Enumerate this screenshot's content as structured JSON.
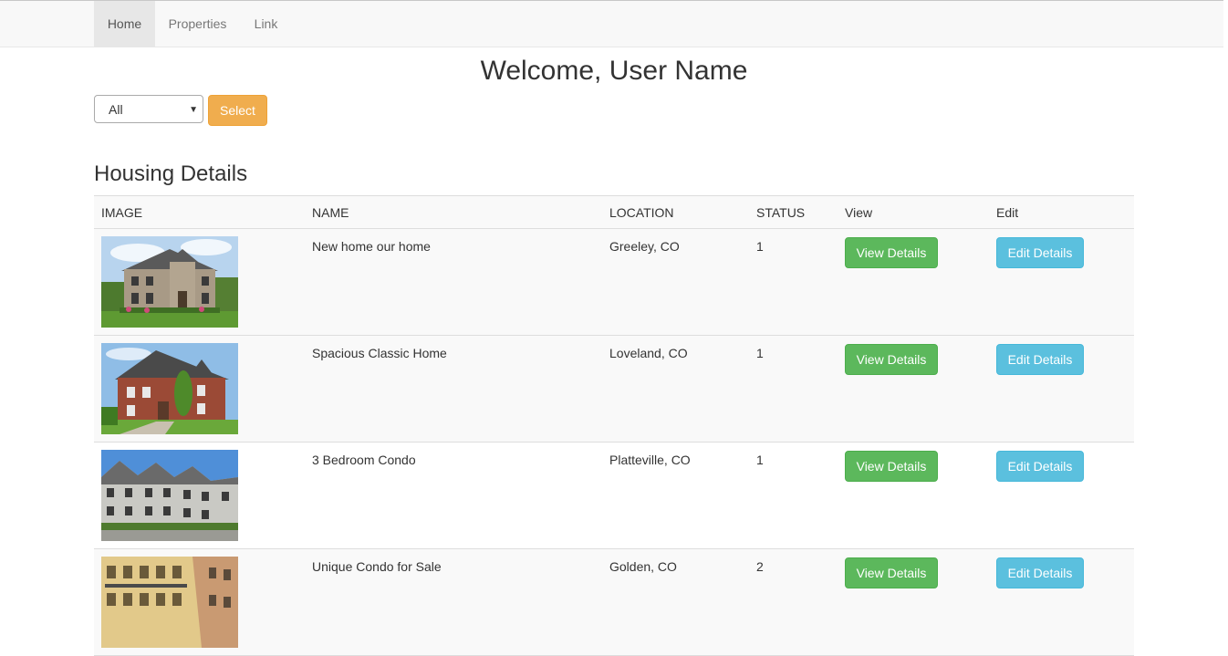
{
  "nav": {
    "items": [
      {
        "label": "Home",
        "active": true
      },
      {
        "label": "Properties",
        "active": false
      },
      {
        "label": "Link",
        "active": false
      }
    ]
  },
  "welcome": "Welcome, User Name",
  "filter": {
    "selected": "All",
    "button_label": "Select"
  },
  "section_title": "Housing Details",
  "table": {
    "headers": [
      "IMAGE",
      "NAME",
      "LOCATION",
      "STATUS",
      "View",
      "Edit"
    ],
    "rows": [
      {
        "name": "New home our home",
        "location": "Greeley, CO",
        "status": "1",
        "view_label": "View Details",
        "edit_label": "Edit Details",
        "image": "stone-house-photo"
      },
      {
        "name": "Spacious Classic Home",
        "location": "Loveland, CO",
        "status": "1",
        "view_label": "View Details",
        "edit_label": "Edit Details",
        "image": "brick-house-photo"
      },
      {
        "name": "3 Bedroom Condo",
        "location": "Platteville, CO",
        "status": "1",
        "view_label": "View Details",
        "edit_label": "Edit Details",
        "image": "townhouse-row-photo"
      },
      {
        "name": "Unique Condo for Sale",
        "location": "Golden, CO",
        "status": "2",
        "view_label": "View Details",
        "edit_label": "Edit Details",
        "image": "yellow-condo-photo"
      }
    ]
  },
  "colors": {
    "select_button": "#f0ad4e",
    "view_button": "#5cb85c",
    "edit_button": "#5bc0de",
    "navbar_bg": "#f8f8f8"
  }
}
